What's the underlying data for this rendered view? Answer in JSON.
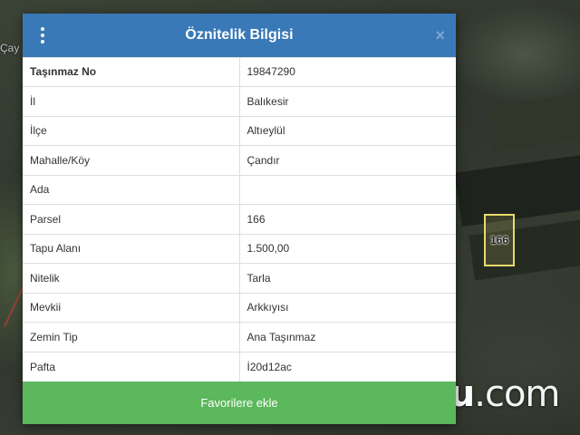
{
  "map": {
    "place_label": "Çay",
    "parcel_label": "166"
  },
  "brand": {
    "name_bold": "tapu",
    "name_light": ".com"
  },
  "modal": {
    "title": "Öznitelik Bilgisi",
    "close_symbol": "×",
    "rows": [
      {
        "key": "Taşınmaz No",
        "value": "19847290"
      },
      {
        "key": "İl",
        "value": "Balıkesir"
      },
      {
        "key": "İlçe",
        "value": "Altıeylül"
      },
      {
        "key": "Mahalle/Köy",
        "value": "Çandır"
      },
      {
        "key": "Ada",
        "value": ""
      },
      {
        "key": "Parsel",
        "value": "166"
      },
      {
        "key": "Tapu Alanı",
        "value": "1.500,00"
      },
      {
        "key": "Nitelik",
        "value": "Tarla"
      },
      {
        "key": "Mevkii",
        "value": "Arkkıyısı"
      },
      {
        "key": "Zemin Tip",
        "value": "Ana Taşınmaz"
      },
      {
        "key": "Pafta",
        "value": "İ20d12ac"
      }
    ],
    "favorite_button": "Favorilere ekle"
  },
  "colors": {
    "header": "#3a79b7",
    "button": "#5cb85c",
    "parcel_outline": "#e6dc6a"
  }
}
